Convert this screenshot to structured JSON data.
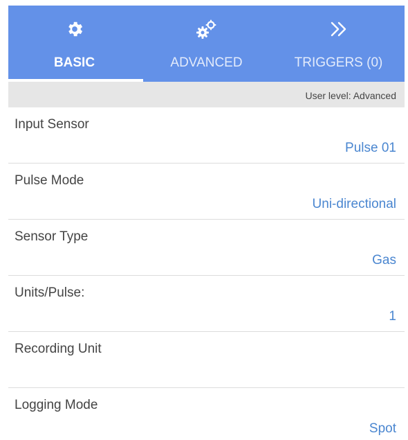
{
  "tabs": [
    {
      "label": "BASIC",
      "icon": "gear-icon",
      "active": true
    },
    {
      "label": "ADVANCED",
      "icon": "gears-icon",
      "active": false
    },
    {
      "label": "TRIGGERS (0)",
      "icon": "double-chevron-right-icon",
      "active": false
    }
  ],
  "user_level": "User level: Advanced",
  "settings": [
    {
      "name": "Input Sensor",
      "value": "Pulse 01"
    },
    {
      "name": "Pulse Mode",
      "value": "Uni-directional"
    },
    {
      "name": "Sensor Type",
      "value": "Gas"
    },
    {
      "name": "Units/Pulse:",
      "value": "1"
    },
    {
      "name": "Recording Unit",
      "value": ""
    },
    {
      "name": "Logging Mode",
      "value": "Spot"
    }
  ],
  "colors": {
    "tab_bar": "#6391e8",
    "value_text": "#4a86d0",
    "label_text": "#444444",
    "level_bar": "#e6e6e6"
  }
}
